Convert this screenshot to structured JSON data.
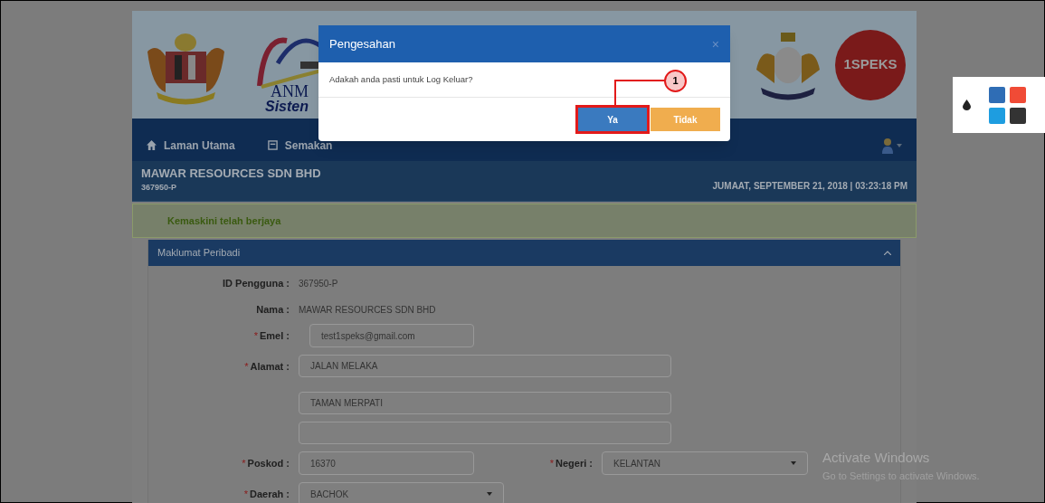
{
  "banner": {
    "anm_logo": {
      "line_1": "ANM",
      "line_2": "Sisten"
    },
    "speks_logo": "1SPEKS"
  },
  "nav": {
    "items": [
      {
        "label": "Laman Utama"
      },
      {
        "label": "Semakan"
      }
    ]
  },
  "company": {
    "name": "MAWAR RESOURCES SDN BHD",
    "id": "367950-P",
    "datetime": "JUMAAT, SEPTEMBER 21, 2018 | 03:23:18 PM"
  },
  "alert": "Kemaskini telah berjaya",
  "panel": {
    "title": "Maklumat Peribadi",
    "rows": [
      {
        "fields": [
          {
            "kind": "text",
            "label": "ID Pengguna :",
            "value": "367950-P"
          }
        ]
      },
      {
        "fields": [
          {
            "kind": "text",
            "label": "Nama :",
            "value": "MAWAR RESOURCES SDN BHD"
          }
        ]
      },
      {
        "fields": [
          {
            "kind": "input",
            "required_mark": "*",
            "label": "Emel :",
            "value": "test1speks@gmail.com"
          }
        ]
      },
      {
        "fields": [
          {
            "kind": "address",
            "required_mark": "*",
            "label": "Alamat :",
            "lines": [
              "JALAN MELAKA",
              "TAMAN MERPATI"
            ]
          }
        ]
      },
      {
        "fields": [
          {
            "kind": "input",
            "required_mark": "*",
            "label": "Poskod :",
            "value": "16370"
          },
          {
            "kind": "select",
            "required_mark": "*",
            "label": "Negeri :",
            "value": "KELANTAN"
          }
        ]
      },
      {
        "fields": [
          {
            "kind": "select",
            "required_mark": "*",
            "label": "Daerah :",
            "value": "BACHOK"
          }
        ]
      }
    ]
  },
  "dialog": {
    "title": "Pengesahan",
    "close": "×",
    "message": "Adakah anda pasti untuk Log Keluar?",
    "buttons": [
      {
        "label": "Ya",
        "kind": "primary",
        "highlighted": true
      },
      {
        "label": "Tidak",
        "kind": "warning",
        "highlighted": false
      }
    ],
    "annotation": "1"
  },
  "theme_picker": {
    "swatches": [
      {
        "color": "#2f6db5"
      },
      {
        "color": "#f04b36"
      },
      {
        "color": "#1e9de0"
      },
      {
        "color": "#333333"
      }
    ]
  },
  "activation_notice": {
    "title": "Activate Windows",
    "subtitle": "Go to Settings to activate Windows."
  }
}
